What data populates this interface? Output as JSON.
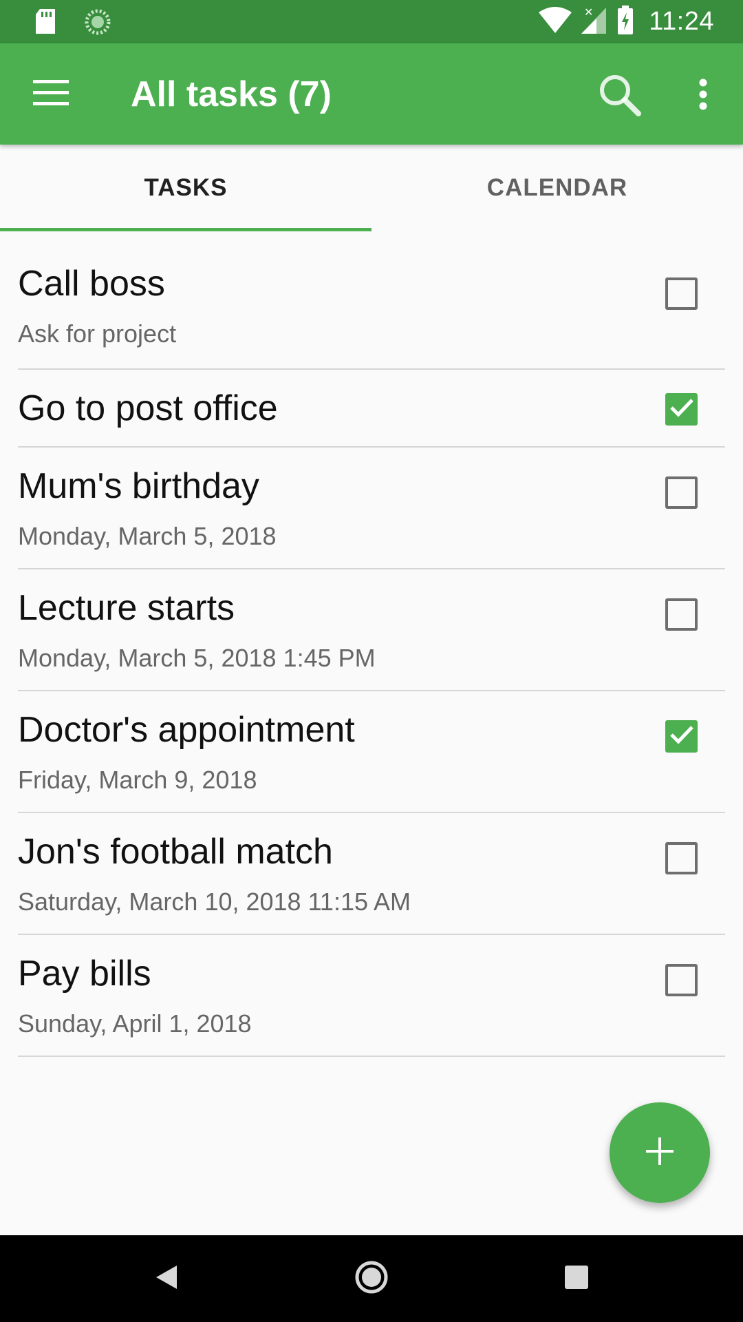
{
  "status_bar": {
    "time": "11:24",
    "icons": [
      "sd-card-icon",
      "sync-icon",
      "wifi-icon",
      "signal-icon",
      "battery-charging-icon"
    ]
  },
  "app_bar": {
    "title": "All tasks (7)",
    "icons": [
      "menu-icon",
      "search-icon",
      "more-vert-icon"
    ]
  },
  "tabs": [
    {
      "label": "TASKS",
      "selected": true
    },
    {
      "label": "CALENDAR",
      "selected": false
    }
  ],
  "tasks": [
    {
      "title": "Call boss",
      "subtitle": "Ask for project",
      "checked": false
    },
    {
      "title": "Go to post office",
      "subtitle": "",
      "checked": true
    },
    {
      "title": "Mum's birthday",
      "subtitle": "Monday, March 5, 2018",
      "checked": false
    },
    {
      "title": "Lecture starts",
      "subtitle": "Monday, March 5, 2018 1:45 PM",
      "checked": false
    },
    {
      "title": "Doctor's appointment",
      "subtitle": "Friday, March 9, 2018",
      "checked": true
    },
    {
      "title": "Jon's football match",
      "subtitle": "Saturday, March 10, 2018 11:15 AM",
      "checked": false
    },
    {
      "title": "Pay bills",
      "subtitle": "Sunday, April 1, 2018",
      "checked": false
    }
  ],
  "fab": {
    "icon": "add-icon"
  },
  "nav_bar": {
    "icons": [
      "back-icon",
      "home-icon",
      "recents-icon"
    ]
  },
  "colors": {
    "primary": "#4caf50",
    "primary_dark": "#388e3c",
    "checkbox_unchecked": "#6e6e6e",
    "background": "#fafafa"
  }
}
